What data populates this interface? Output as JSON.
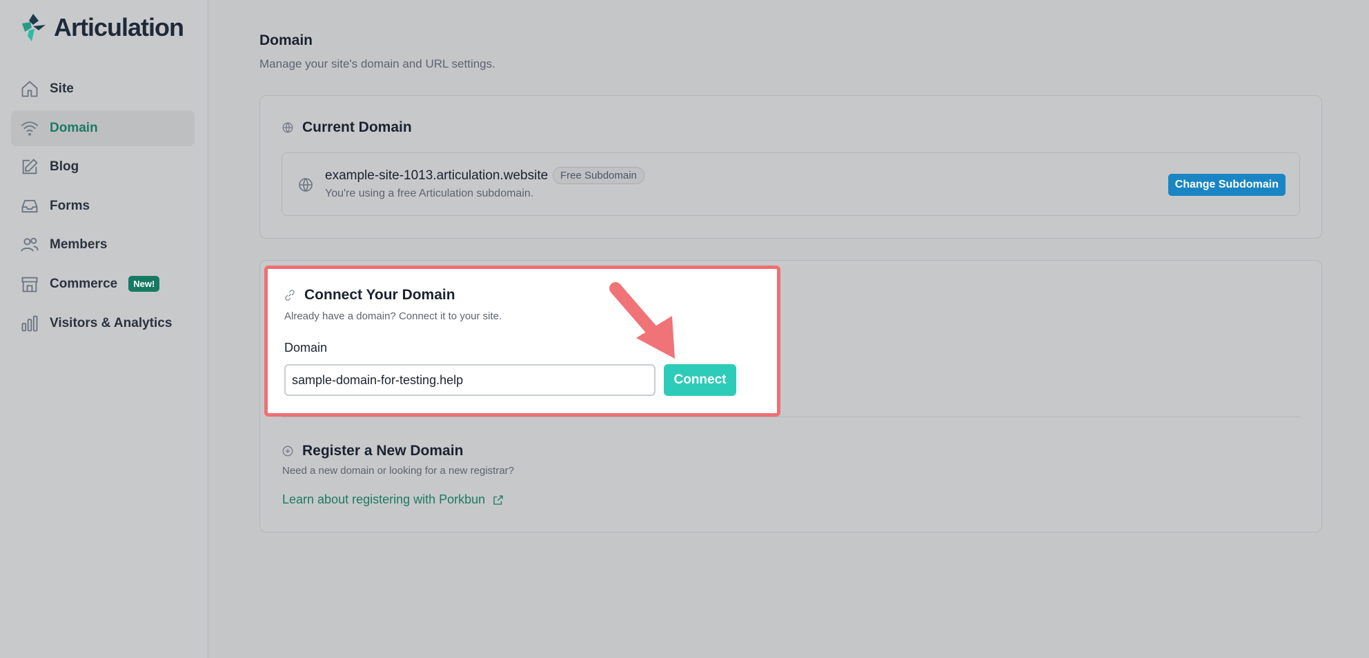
{
  "app": {
    "name": "Articulation"
  },
  "sidebar": {
    "items": [
      {
        "label": "Site",
        "icon": "home-icon"
      },
      {
        "label": "Domain",
        "icon": "wifi-icon",
        "active": true
      },
      {
        "label": "Blog",
        "icon": "edit-icon"
      },
      {
        "label": "Forms",
        "icon": "inbox-icon"
      },
      {
        "label": "Members",
        "icon": "users-icon"
      },
      {
        "label": "Commerce",
        "icon": "store-icon",
        "badge": "New!"
      },
      {
        "label": "Visitors & Analytics",
        "icon": "bar-chart-icon"
      }
    ]
  },
  "page": {
    "title": "Domain",
    "subtitle": "Manage your site's domain and URL settings."
  },
  "current_domain": {
    "heading": "Current Domain",
    "domain": "example-site-1013.articulation.website",
    "badge": "Free Subdomain",
    "note": "You're using a free Articulation subdomain.",
    "change_button": "Change Subdomain"
  },
  "connect": {
    "heading": "Connect Your Domain",
    "subtitle": "Already have a domain? Connect it to your site.",
    "field_label": "Domain",
    "input_value": "sample-domain-for-testing.help",
    "button": "Connect"
  },
  "register": {
    "heading": "Register a New Domain",
    "subtitle": "Need a new domain or looking for a new registrar?",
    "link": "Learn about registering with Porkbun"
  },
  "colors": {
    "accent": "#1d7a63",
    "connect_button": "#2dccb8",
    "change_button": "#1a85c4",
    "highlight": "#ef6f74"
  }
}
